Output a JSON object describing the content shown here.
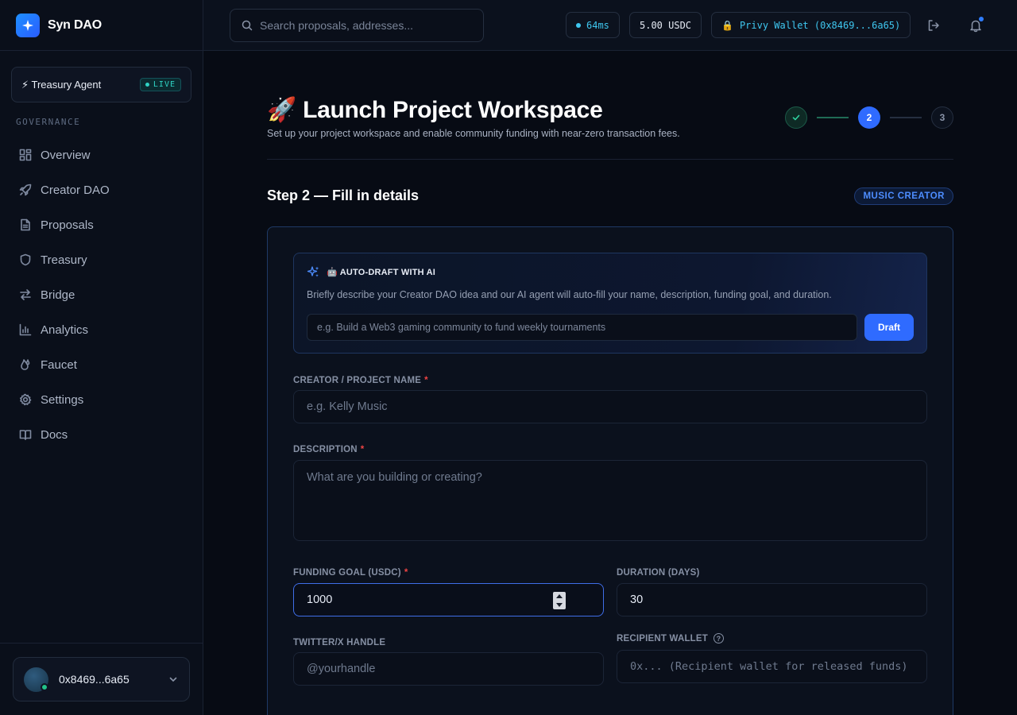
{
  "brand": {
    "name": "Syn DAO"
  },
  "agent": {
    "label": "⚡ Treasury Agent",
    "status": "LIVE"
  },
  "sidebar": {
    "section_label": "GOVERNANCE",
    "items": [
      {
        "label": "Overview",
        "icon": "grid-icon"
      },
      {
        "label": "Creator DAO",
        "icon": "rocket-icon"
      },
      {
        "label": "Proposals",
        "icon": "document-icon"
      },
      {
        "label": "Treasury",
        "icon": "shield-icon"
      },
      {
        "label": "Bridge",
        "icon": "arrows-icon"
      },
      {
        "label": "Analytics",
        "icon": "bar-chart-icon"
      },
      {
        "label": "Faucet",
        "icon": "droplet-icon"
      },
      {
        "label": "Settings",
        "icon": "gear-icon"
      },
      {
        "label": "Docs",
        "icon": "book-icon"
      }
    ],
    "user": {
      "address": "0x8469...6a65"
    }
  },
  "topbar": {
    "search_placeholder": "Search proposals, addresses...",
    "latency": "64ms",
    "balance": "5.00 USDC",
    "wallet": "Privy Wallet (0x8469...6a65)",
    "wallet_icon": "🔒"
  },
  "page": {
    "title": "🚀 Launch Project Workspace",
    "subtitle": "Set up your project workspace and enable community funding with near-zero transaction fees.",
    "steps": [
      {
        "label": "✓",
        "state": "done"
      },
      {
        "label": "2",
        "state": "active"
      },
      {
        "label": "3",
        "state": "idle"
      }
    ],
    "step_heading": "Step 2 — Fill in details",
    "category": "MUSIC CREATOR"
  },
  "ai_draft": {
    "title": "🤖 AUTO-DRAFT WITH AI",
    "description": "Briefly describe your Creator DAO idea and our AI agent will auto-fill your name, description, funding goal, and duration.",
    "placeholder": "e.g. Build a Web3 gaming community to fund weekly tournaments",
    "button": "Draft"
  },
  "form": {
    "name_label": "CREATOR / PROJECT NAME",
    "name_placeholder": "e.g. Kelly Music",
    "description_label": "DESCRIPTION",
    "description_placeholder": "What are you building or creating?",
    "goal_label": "FUNDING GOAL (USDC)",
    "goal_value": "1000",
    "duration_label": "DURATION (DAYS)",
    "duration_value": "30",
    "twitter_label": "TWITTER/X HANDLE",
    "twitter_placeholder": "@yourhandle",
    "recipient_label": "RECIPIENT WALLET",
    "recipient_placeholder": "0x... (Recipient wallet for released funds)",
    "required_mark": "*"
  },
  "colors": {
    "accent": "#2f6bff",
    "cyan": "#3fc7f0",
    "success": "#22c389",
    "background": "#070b14"
  }
}
